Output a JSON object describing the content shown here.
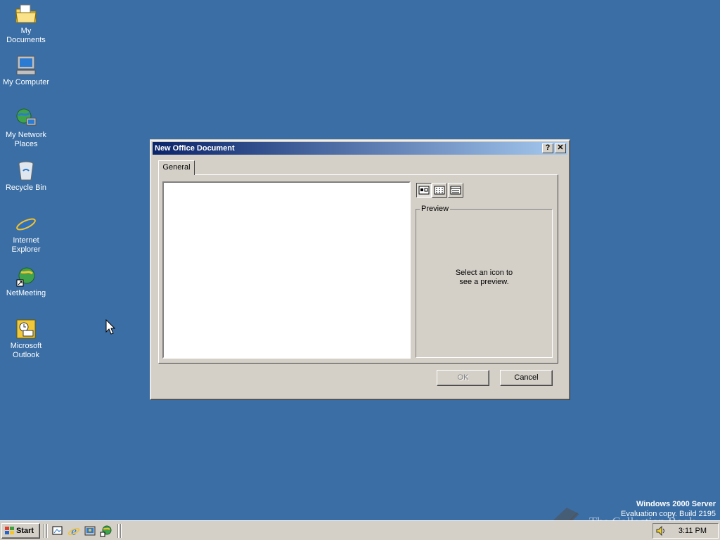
{
  "desktop": {
    "icons": [
      {
        "label": "My Documents"
      },
      {
        "label": "My Computer"
      },
      {
        "label": "My Network Places"
      },
      {
        "label": "Recycle Bin"
      },
      {
        "label": "Internet Explorer"
      },
      {
        "label": "NetMeeting"
      },
      {
        "label": "Microsoft Outlook"
      }
    ],
    "os_line1": "Windows 2000 Server",
    "os_line2": "Evaluation copy. Build 2195",
    "watermark": "The Collection Book"
  },
  "dialog": {
    "title": "New Office Document",
    "help_label": "?",
    "close_label": "✕",
    "tab_label": "General",
    "view_buttons": [
      "large-icons",
      "list",
      "details"
    ],
    "preview_label": "Preview",
    "preview_line1": "Select an icon to",
    "preview_line2": "see a preview.",
    "ok_label": "OK",
    "cancel_label": "Cancel"
  },
  "taskbar": {
    "start_label": "Start",
    "quick_launch": [
      "show-desktop-icon",
      "internet-explorer-icon",
      "outlook-icon",
      "netmeeting-icon"
    ],
    "clock": "3:11 PM"
  },
  "colors": {
    "desktop": "#3a6ea5",
    "title_active_start": "#0a246a",
    "title_active_end": "#a6caf0",
    "face": "#d4d0c8"
  }
}
